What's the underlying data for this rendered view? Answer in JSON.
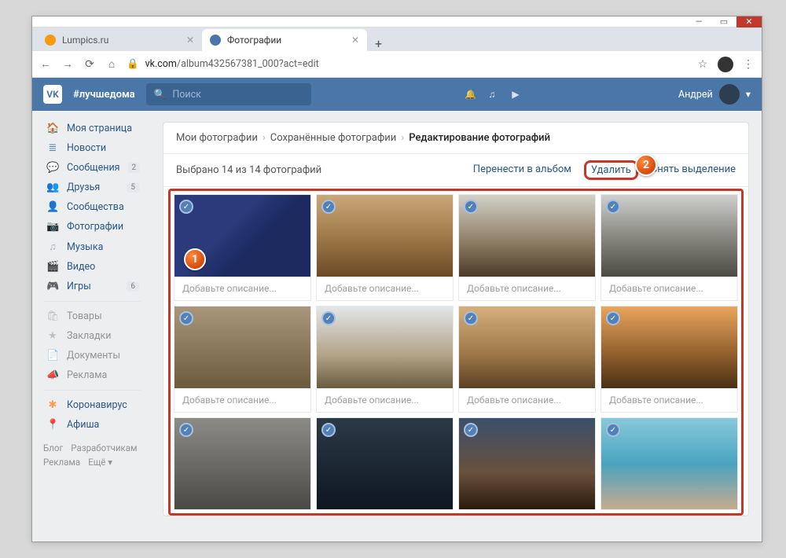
{
  "browser": {
    "tabs": [
      {
        "label": "Lumpics.ru",
        "active": false,
        "favicon": "#f39c12"
      },
      {
        "label": "Фотографии",
        "active": true,
        "favicon": "#4a76a8"
      }
    ],
    "url_host": "vk.com",
    "url_path": "/album432567381_000?act=edit"
  },
  "vk": {
    "hashtag": "#лучшедома",
    "search_placeholder": "Поиск",
    "user_name": "Андрей"
  },
  "sidebar": {
    "items": [
      {
        "icon": "🏠",
        "label": "Моя страница"
      },
      {
        "icon": "≣",
        "label": "Новости",
        "cls": "news"
      },
      {
        "icon": "💬",
        "label": "Сообщения",
        "badge": "2"
      },
      {
        "icon": "👥",
        "label": "Друзья",
        "badge": "5"
      },
      {
        "icon": "👤",
        "label": "Сообщества"
      },
      {
        "icon": "📷",
        "label": "Фотографии"
      },
      {
        "icon": "♫",
        "label": "Музыка"
      },
      {
        "icon": "🎬",
        "label": "Видео"
      },
      {
        "icon": "🎮",
        "label": "Игры",
        "badge": "6"
      }
    ],
    "items2": [
      {
        "icon": "🛍",
        "label": "Товары"
      },
      {
        "icon": "★",
        "label": "Закладки"
      },
      {
        "icon": "📄",
        "label": "Документы"
      },
      {
        "icon": "📣",
        "label": "Реклама"
      }
    ],
    "items3": [
      {
        "icon": "✱",
        "label": "Коронавирус",
        "cls": "corona"
      },
      {
        "icon": "📍",
        "label": "Афиша"
      }
    ],
    "footer": [
      "Блог",
      "Разработчикам",
      "Реклама",
      "Ещё ▾"
    ]
  },
  "breadcrumb": {
    "a": "Мои фотографии",
    "b": "Сохранённые фотографии",
    "c": "Редактирование фотографий"
  },
  "toolbar": {
    "selected_text": "Выбрано 14 из 14 фотографий",
    "move": "Перенести в альбом",
    "delete": "Удалить",
    "deselect": "Снять выделение"
  },
  "photos": {
    "caption_placeholder": "Добавьте описание..."
  }
}
